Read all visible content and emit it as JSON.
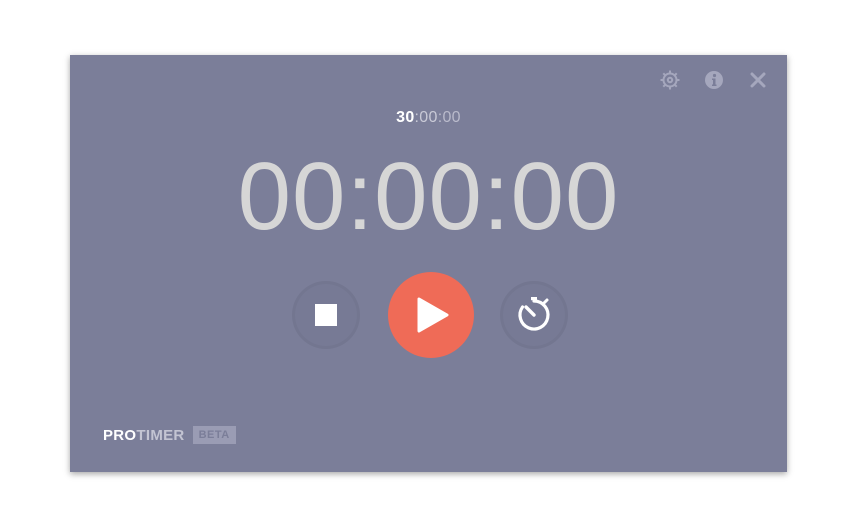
{
  "preset": {
    "hours": "30",
    "minutes": ":00",
    "seconds": ":00"
  },
  "clock": {
    "display": "00:00:00"
  },
  "controls": {
    "stop": "stop-icon",
    "play": "play-icon",
    "lap": "stopwatch-icon"
  },
  "top_icons": [
    "gear-icon",
    "info-icon",
    "close-icon"
  ],
  "brand": {
    "pro": "PRO",
    "timer": "TIMER",
    "badge": "BETA"
  },
  "colors": {
    "background": "#7b7e99",
    "accent": "#ef6b57",
    "clock_text": "#d6d6d6"
  }
}
